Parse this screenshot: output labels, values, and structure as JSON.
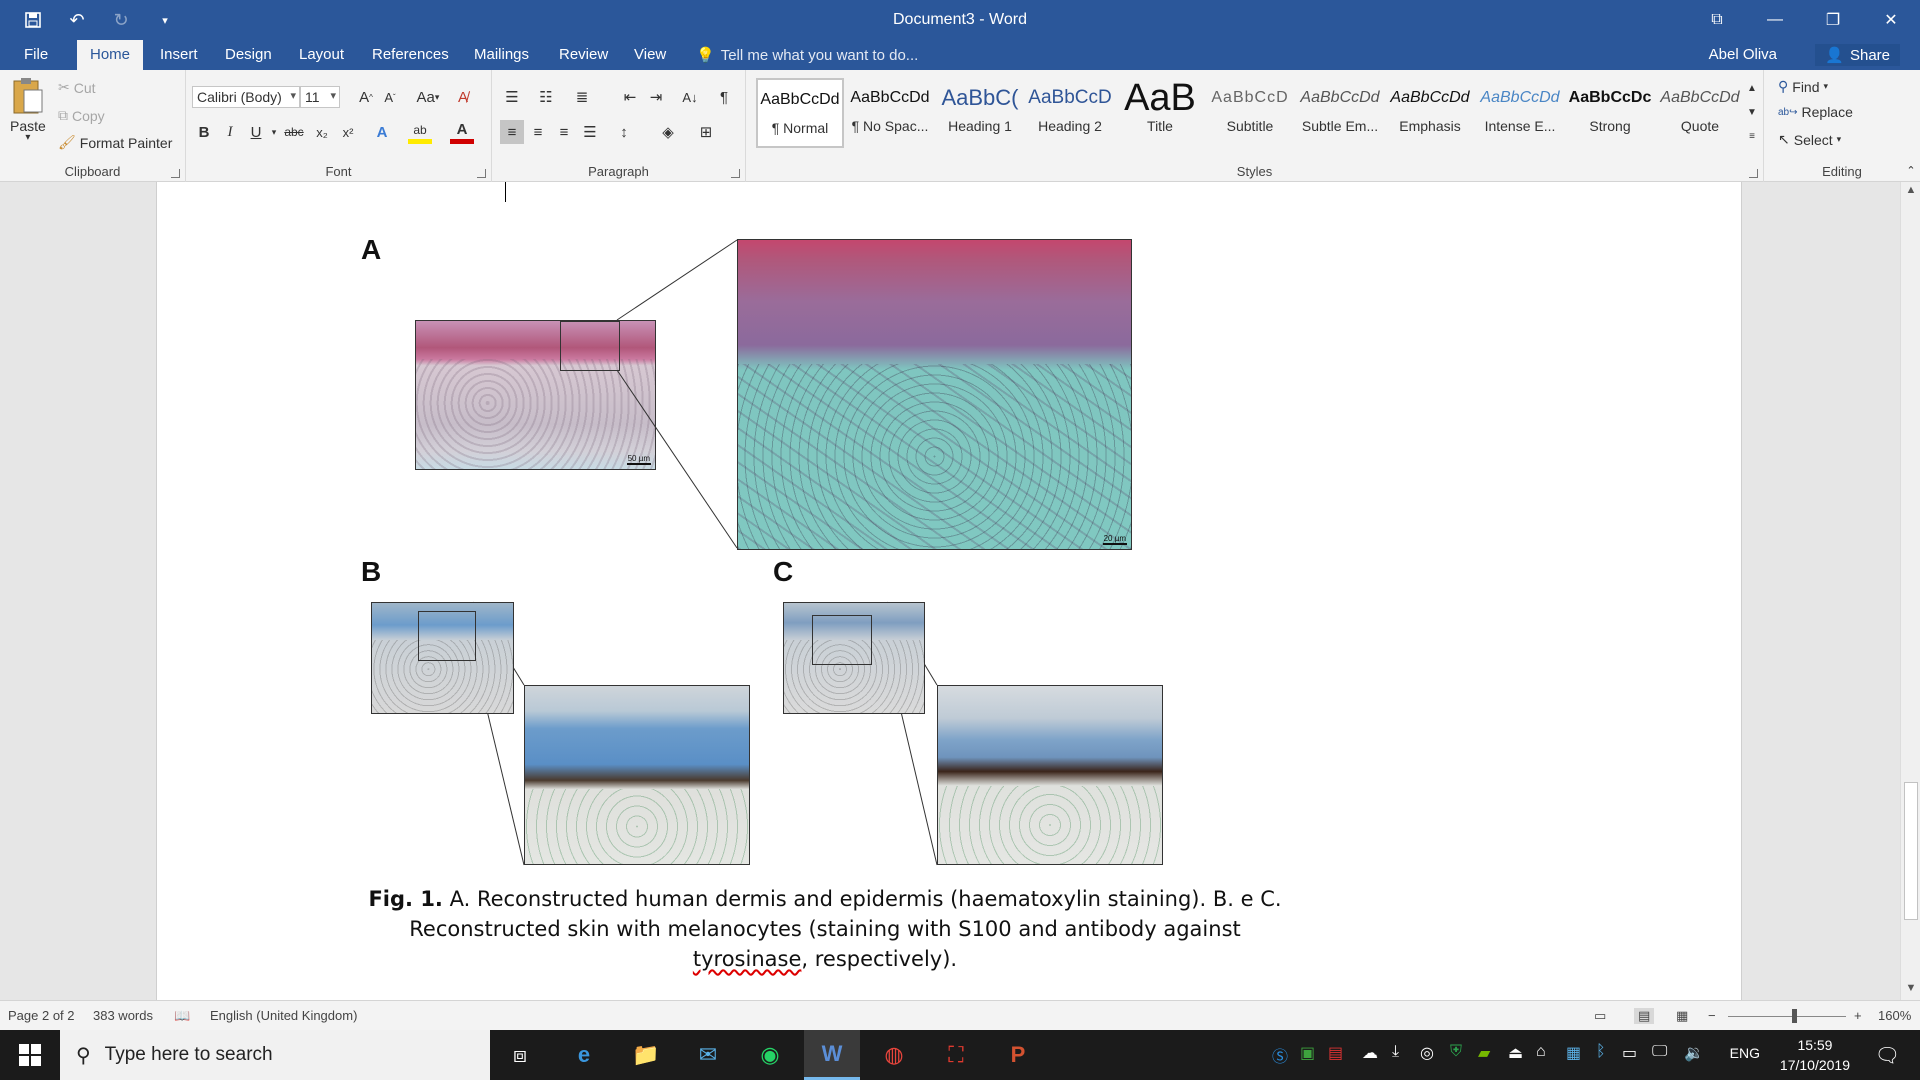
{
  "window": {
    "title": "Document3 - Word",
    "restore_icon": "restore-down-icon",
    "controls": [
      "ribbon-display-icon",
      "minimize-icon",
      "maximize-icon",
      "close-icon"
    ]
  },
  "qat": {
    "undo_icon": "undo-icon",
    "redo_icon": "redo-icon",
    "save_icon": "save-icon"
  },
  "tabs": [
    "File",
    "Home",
    "Insert",
    "Design",
    "Layout",
    "References",
    "Mailings",
    "Review",
    "View"
  ],
  "active_tab": "Home",
  "tell_me": "Tell me what you want to do...",
  "user": "Abel Oliva",
  "share_label": "Share",
  "clipboard": {
    "paste": "Paste",
    "cut": "Cut",
    "copy": "Copy",
    "format_painter": "Format Painter",
    "group": "Clipboard"
  },
  "font": {
    "name": "Calibri (Body)",
    "size": "11",
    "group": "Font",
    "change_case": "Aa"
  },
  "paragraph": {
    "group": "Paragraph"
  },
  "styles": {
    "group": "Styles",
    "items": [
      {
        "sample": "AaBbCcDd",
        "name": "¶ Normal"
      },
      {
        "sample": "AaBbCcDd",
        "name": "¶ No Spac..."
      },
      {
        "sample": "AaBbC(",
        "name": "Heading 1"
      },
      {
        "sample": "AaBbCcD",
        "name": "Heading 2"
      },
      {
        "sample": "AaB",
        "name": "Title"
      },
      {
        "sample": "AaBbCcD",
        "name": "Subtitle"
      },
      {
        "sample": "AaBbCcDd",
        "name": "Subtle Em..."
      },
      {
        "sample": "AaBbCcDd",
        "name": "Emphasis"
      },
      {
        "sample": "AaBbCcDd",
        "name": "Intense E..."
      },
      {
        "sample": "AaBbCcDc",
        "name": "Strong"
      },
      {
        "sample": "AaBbCcDd",
        "name": "Quote"
      }
    ]
  },
  "editing": {
    "find": "Find",
    "replace": "Replace",
    "select": "Select",
    "group": "Editing"
  },
  "figure": {
    "letters": [
      "A",
      "B",
      "C"
    ],
    "scale_small": "50 µm",
    "scale_large": "20 µm",
    "caption_bold": "Fig. 1.",
    "caption_line1": " A. Reconstructed human dermis and epidermis (haematoxylin staining). B. e C.",
    "caption_line2": "Reconstructed skin with melanocytes (staining with S100 and antibody against",
    "caption_misspelled": "tyrosinase",
    "caption_end": ", respectively)."
  },
  "status": {
    "page": "Page 2 of 2",
    "words": "383 words",
    "language": "English (United Kingdom)",
    "zoom": "160%"
  },
  "taskbar": {
    "search_placeholder": "Type here to search",
    "lang": "ENG",
    "time": "15:59",
    "date": "17/10/2019"
  },
  "colors": {
    "brand": "#2b579a",
    "he_pink": "#b1577a",
    "he_teal": "#7fc6c0",
    "ihc_blue": "#6c9ccb"
  }
}
